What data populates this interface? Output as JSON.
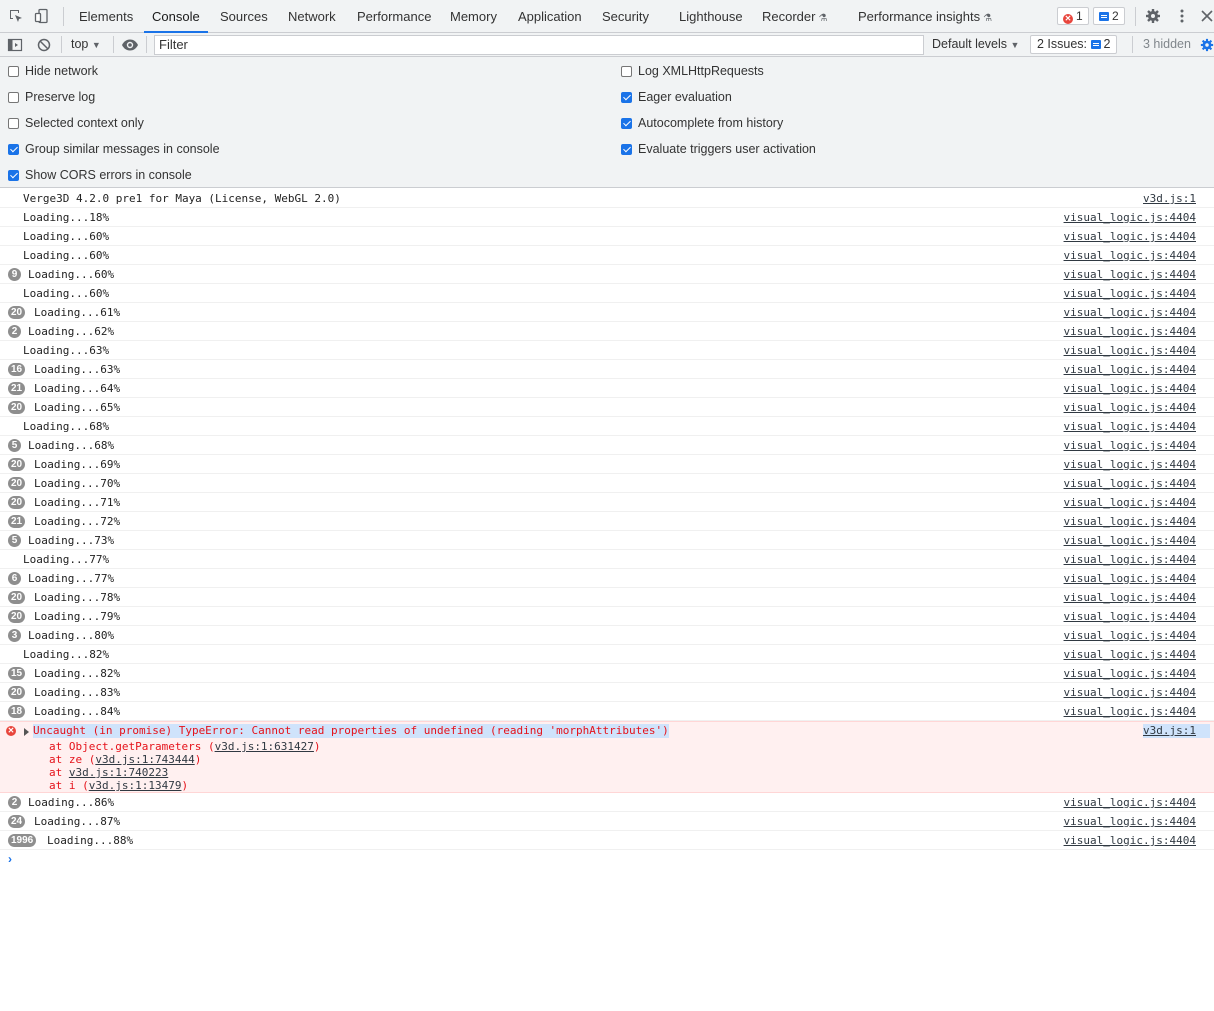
{
  "tabs": [
    {
      "label": "Elements"
    },
    {
      "label": "Console"
    },
    {
      "label": "Sources"
    },
    {
      "label": "Network"
    },
    {
      "label": "Performance"
    },
    {
      "label": "Memory"
    },
    {
      "label": "Application"
    },
    {
      "label": "Security"
    },
    {
      "label": "Lighthouse"
    },
    {
      "label": "Recorder"
    },
    {
      "label": "Performance insights"
    }
  ],
  "active_tab": "Console",
  "error_count": "1",
  "message_count": "2",
  "toolbar": {
    "context": "top",
    "filter_placeholder": "Filter",
    "levels": "Default levels",
    "issues_label": "2 Issues:",
    "issues_count": "2",
    "hidden": "3 hidden"
  },
  "settings": {
    "left": [
      {
        "label": "Hide network",
        "checked": false
      },
      {
        "label": "Preserve log",
        "checked": false
      },
      {
        "label": "Selected context only",
        "checked": false
      },
      {
        "label": "Group similar messages in console",
        "checked": true
      },
      {
        "label": "Show CORS errors in console",
        "checked": true
      }
    ],
    "right": [
      {
        "label": "Log XMLHttpRequests",
        "checked": false
      },
      {
        "label": "Eager evaluation",
        "checked": true
      },
      {
        "label": "Autocomplete from history",
        "checked": true
      },
      {
        "label": "Evaluate triggers user activation",
        "checked": true
      }
    ]
  },
  "logs_before": [
    {
      "count": "",
      "text": "Verge3D 4.2.0 pre1 for Maya (License, WebGL 2.0)",
      "src": "v3d.js:1"
    },
    {
      "count": "",
      "text": "Loading...18%",
      "src": "visual_logic.js:4404"
    },
    {
      "count": "",
      "text": "Loading...60%",
      "src": "visual_logic.js:4404"
    },
    {
      "count": "",
      "text": "Loading...60%",
      "src": "visual_logic.js:4404"
    },
    {
      "count": "9",
      "text": "Loading...60%",
      "src": "visual_logic.js:4404"
    },
    {
      "count": "",
      "text": "Loading...60%",
      "src": "visual_logic.js:4404"
    },
    {
      "count": "20",
      "text": "Loading...61%",
      "src": "visual_logic.js:4404"
    },
    {
      "count": "2",
      "text": "Loading...62%",
      "src": "visual_logic.js:4404"
    },
    {
      "count": "",
      "text": "Loading...63%",
      "src": "visual_logic.js:4404"
    },
    {
      "count": "16",
      "text": "Loading...63%",
      "src": "visual_logic.js:4404"
    },
    {
      "count": "21",
      "text": "Loading...64%",
      "src": "visual_logic.js:4404"
    },
    {
      "count": "20",
      "text": "Loading...65%",
      "src": "visual_logic.js:4404"
    },
    {
      "count": "",
      "text": "Loading...68%",
      "src": "visual_logic.js:4404"
    },
    {
      "count": "5",
      "text": "Loading...68%",
      "src": "visual_logic.js:4404"
    },
    {
      "count": "20",
      "text": "Loading...69%",
      "src": "visual_logic.js:4404"
    },
    {
      "count": "20",
      "text": "Loading...70%",
      "src": "visual_logic.js:4404"
    },
    {
      "count": "20",
      "text": "Loading...71%",
      "src": "visual_logic.js:4404"
    },
    {
      "count": "21",
      "text": "Loading...72%",
      "src": "visual_logic.js:4404"
    },
    {
      "count": "5",
      "text": "Loading...73%",
      "src": "visual_logic.js:4404"
    },
    {
      "count": "",
      "text": "Loading...77%",
      "src": "visual_logic.js:4404"
    },
    {
      "count": "6",
      "text": "Loading...77%",
      "src": "visual_logic.js:4404"
    },
    {
      "count": "20",
      "text": "Loading...78%",
      "src": "visual_logic.js:4404"
    },
    {
      "count": "20",
      "text": "Loading...79%",
      "src": "visual_logic.js:4404"
    },
    {
      "count": "3",
      "text": "Loading...80%",
      "src": "visual_logic.js:4404"
    },
    {
      "count": "",
      "text": "Loading...82%",
      "src": "visual_logic.js:4404"
    },
    {
      "count": "15",
      "text": "Loading...82%",
      "src": "visual_logic.js:4404"
    },
    {
      "count": "20",
      "text": "Loading...83%",
      "src": "visual_logic.js:4404"
    },
    {
      "count": "18",
      "text": "Loading...84%",
      "src": "visual_logic.js:4404"
    }
  ],
  "error": {
    "message": "Uncaught (in promise) TypeError: Cannot read properties of undefined (reading 'morphAttributes')",
    "src": "v3d.js:1",
    "stack": [
      {
        "prefix": "at Object.getParameters (",
        "link": "v3d.js:1:631427",
        "suffix": ")"
      },
      {
        "prefix": "at ze (",
        "link": "v3d.js:1:743444",
        "suffix": ")"
      },
      {
        "prefix": "at ",
        "link": "v3d.js:1:740223",
        "suffix": ""
      },
      {
        "prefix": "at i (",
        "link": "v3d.js:1:13479",
        "suffix": ")"
      }
    ]
  },
  "logs_after": [
    {
      "count": "2",
      "text": "Loading...86%",
      "src": "visual_logic.js:4404"
    },
    {
      "count": "24",
      "text": "Loading...87%",
      "src": "visual_logic.js:4404"
    },
    {
      "count": "1996",
      "text": "Loading...88%",
      "src": "visual_logic.js:4404"
    }
  ],
  "prompt_symbol": "›"
}
